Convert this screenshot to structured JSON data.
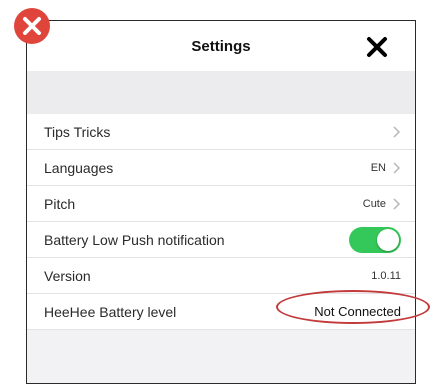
{
  "header": {
    "title": "Settings"
  },
  "rows": [
    {
      "label": "Tips Tricks",
      "value": "",
      "chevron": true
    },
    {
      "label": "Languages",
      "value": "EN",
      "chevron": true
    },
    {
      "label": "Pitch",
      "value": "Cute",
      "chevron": true
    },
    {
      "label": "Battery Low Push notification",
      "toggle_on": true
    },
    {
      "label": "Version",
      "value": "1.0.11"
    },
    {
      "label": "HeeHee Battery level",
      "value": "Not Connected"
    }
  ],
  "colors": {
    "toggle_on": "#34c759",
    "mark_red": "#e0453b",
    "highlight_red": "#c23a3a"
  },
  "icons": {
    "close": "close-icon",
    "chevron": "chevron-right-icon",
    "error_mark": "red-x-icon"
  }
}
